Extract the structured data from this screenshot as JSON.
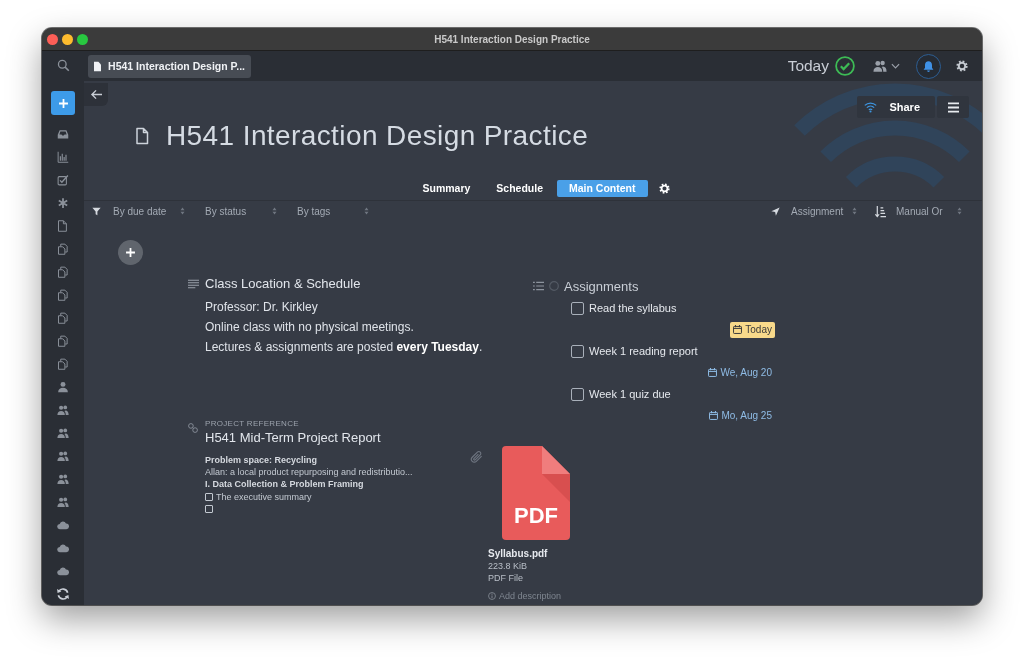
{
  "window": {
    "title": "H541 Interaction Design Practice"
  },
  "sidebar": {
    "items": [
      {
        "kind": "search"
      },
      {
        "kind": "add"
      },
      {
        "kind": "inbox"
      },
      {
        "kind": "chart"
      },
      {
        "kind": "tasks"
      },
      {
        "kind": "asterisk"
      },
      {
        "kind": "page"
      },
      {
        "kind": "copy"
      },
      {
        "kind": "copy"
      },
      {
        "kind": "copy"
      },
      {
        "kind": "copy"
      },
      {
        "kind": "copy"
      },
      {
        "kind": "copy"
      },
      {
        "kind": "person"
      },
      {
        "kind": "people"
      },
      {
        "kind": "people"
      },
      {
        "kind": "people"
      },
      {
        "kind": "people"
      },
      {
        "kind": "people"
      },
      {
        "kind": "cloud"
      },
      {
        "kind": "cloud"
      },
      {
        "kind": "cloud"
      },
      {
        "kind": "sync"
      }
    ]
  },
  "topbar": {
    "tabs": [
      {
        "label": "H541 Interaction Design P...",
        "selected": true
      }
    ],
    "today": "Today"
  },
  "document": {
    "title": "H541 Interaction Design Practice",
    "share": "Share",
    "views": [
      {
        "label": "Summary",
        "selected": false
      },
      {
        "label": "Schedule",
        "selected": false
      },
      {
        "label": "Main Content",
        "selected": true
      }
    ],
    "filters": [
      {
        "label": "By due date"
      },
      {
        "label": "By status"
      },
      {
        "label": "By tags"
      }
    ],
    "right_filters": [
      {
        "kind": "location",
        "label": "Assignment"
      },
      {
        "kind": "order",
        "label": "Manual Or"
      }
    ]
  },
  "note": {
    "title": "Class Location & Schedule",
    "lines": [
      "Professor: Dr. Kirkley",
      "Online class with no physical meetings.",
      "Lectures & assignments are posted **every Tuesday**."
    ]
  },
  "assignments": {
    "title": "Assignments",
    "items": [
      {
        "label": "Read the syllabus",
        "checked": false,
        "due": "Today",
        "highlighted": true
      },
      {
        "label": "Week 1 reading report",
        "checked": false,
        "due": "We, Aug 20",
        "highlighted": false
      },
      {
        "label": "Week 1 quiz due",
        "checked": false,
        "due": "Mo, Aug 25",
        "highlighted": false
      }
    ]
  },
  "project_reference": {
    "label": "PROJECT REFERENCE",
    "title": "H541 Mid-Term Project Report",
    "preview": [
      {
        "kind": "heading",
        "text": "Problem space: Recycling"
      },
      {
        "kind": "text",
        "text": "Allan: a local product repurposing and redistributio..."
      },
      {
        "kind": "heading",
        "text": "I. Data Collection & Problem Framing"
      },
      {
        "kind": "task",
        "text": "The executive summary",
        "checked": false
      },
      {
        "kind": "task",
        "checked": false
      }
    ]
  },
  "attachment": {
    "icon_label": "PDF",
    "name": "Syllabus.pdf",
    "size": "223.8 KiB",
    "type": "PDF File",
    "action": "Add description"
  }
}
